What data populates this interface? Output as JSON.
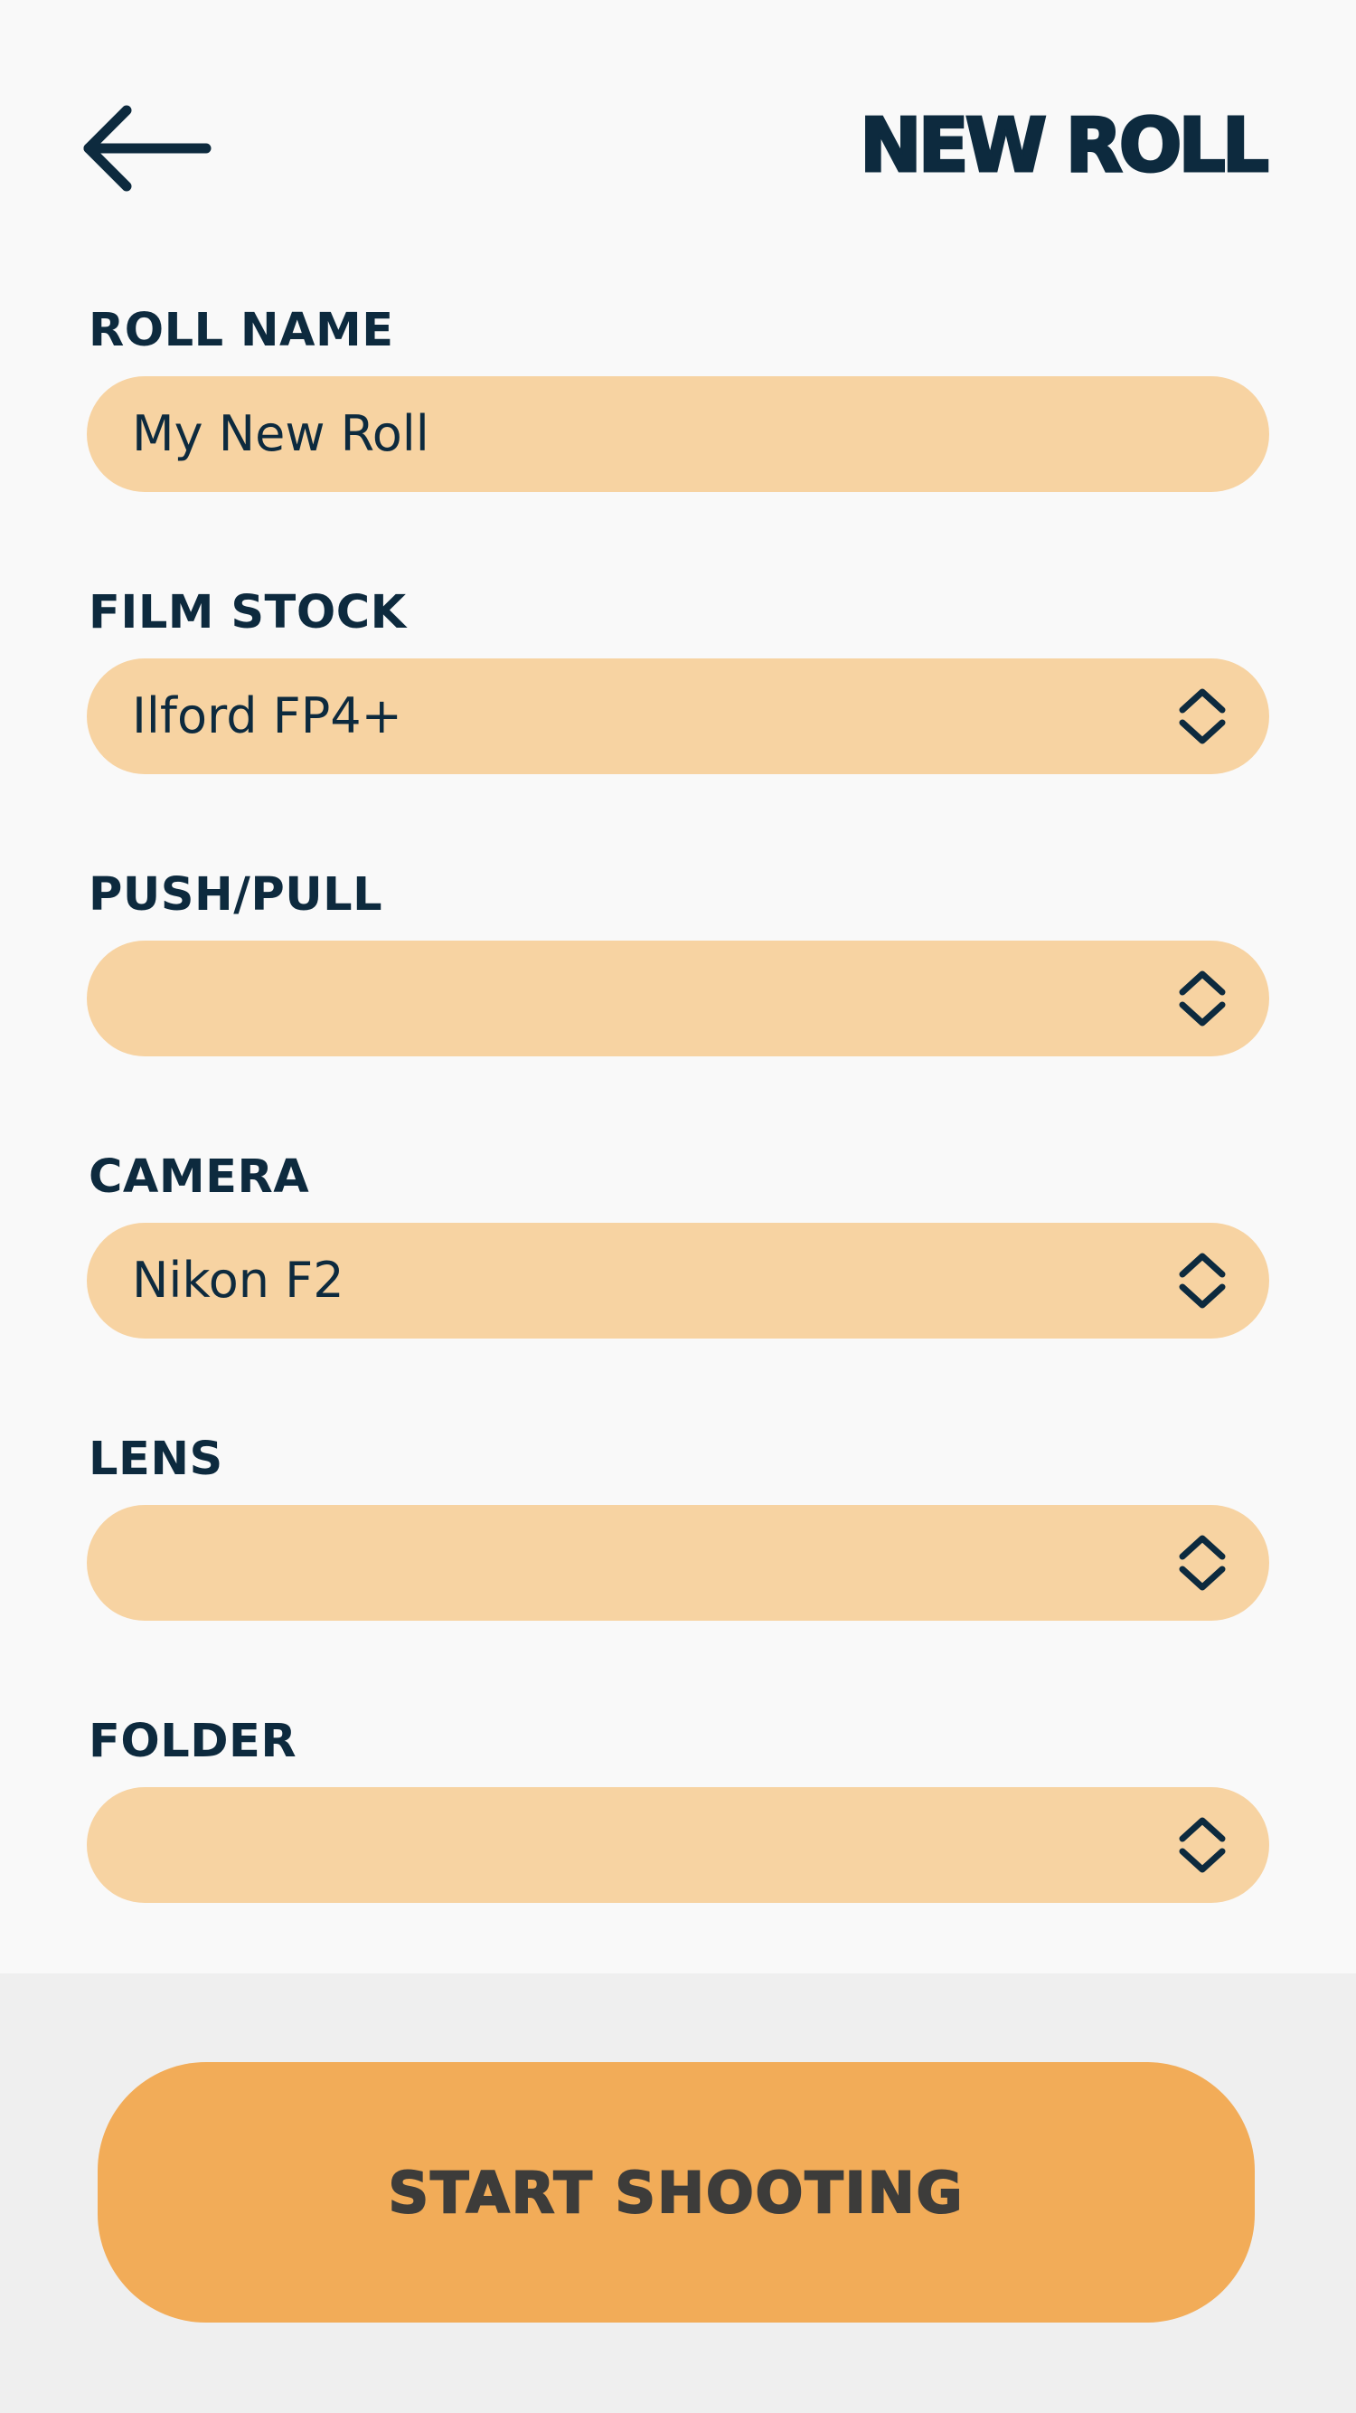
{
  "header": {
    "back_icon": "arrow-left-icon",
    "title": "NEW ROLL"
  },
  "form": {
    "roll_name": {
      "label": "ROLL NAME",
      "value": "My New Roll"
    },
    "film_stock": {
      "label": "FILM STOCK",
      "value": "Ilford FP4+",
      "icon": "chevron-up-down-icon"
    },
    "push_pull": {
      "label": "PUSH/PULL",
      "value": "",
      "icon": "chevron-up-down-icon"
    },
    "camera": {
      "label": "CAMERA",
      "value": "Nikon F2",
      "icon": "chevron-up-down-icon"
    },
    "lens": {
      "label": "LENS",
      "value": "",
      "icon": "chevron-up-down-icon"
    },
    "folder": {
      "label": "FOLDER",
      "value": "",
      "icon": "chevron-up-down-icon"
    }
  },
  "footer": {
    "start_label": "START SHOOTING"
  },
  "colors": {
    "text": "#0d2a3e",
    "field_background": "#f7d3a2",
    "button_background": "#f2ac58",
    "button_text": "#3d3c3a",
    "page_background": "#f9f9f9",
    "footer_background": "#efefef"
  }
}
